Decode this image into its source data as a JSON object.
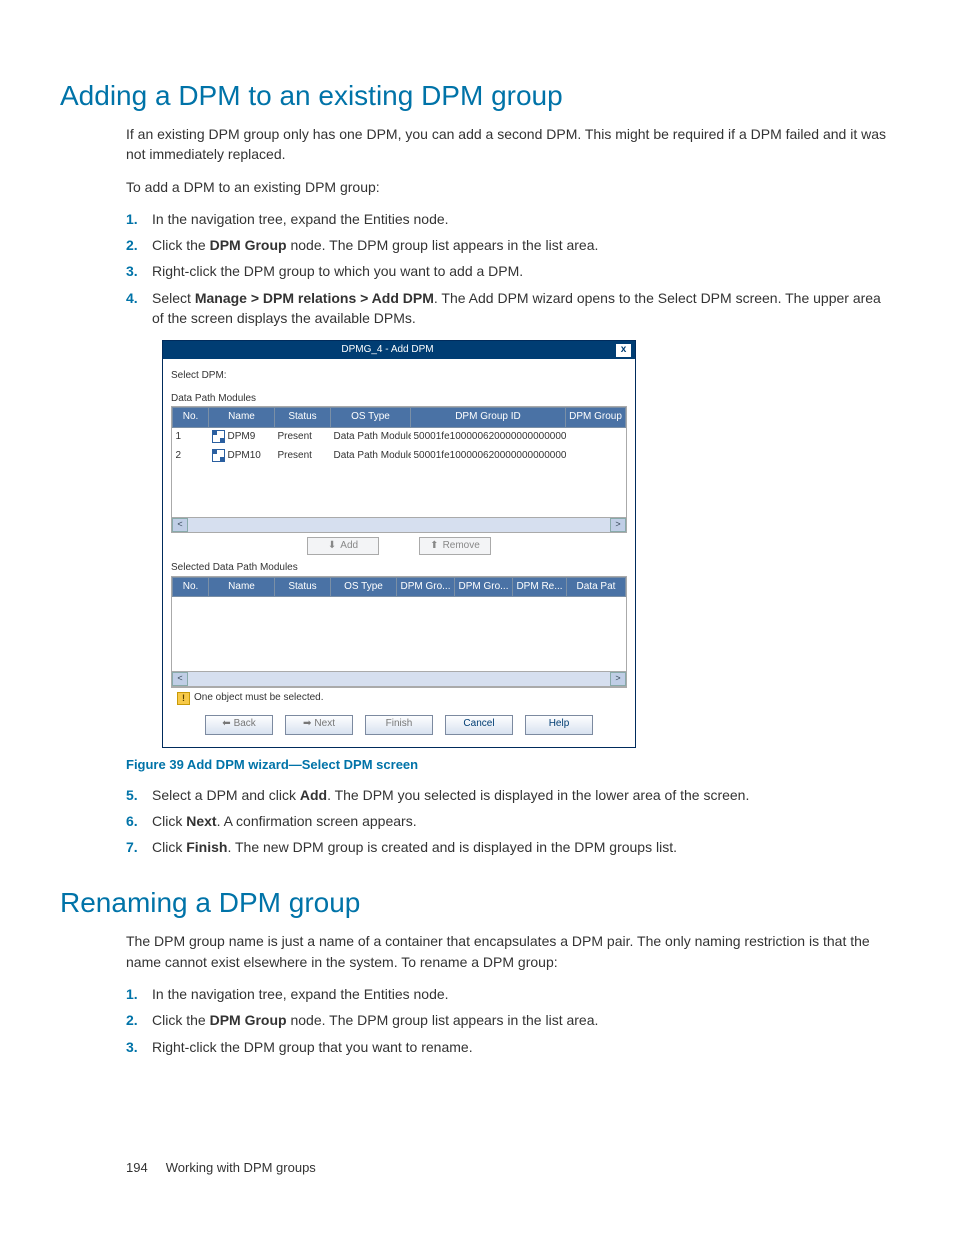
{
  "section1": {
    "heading": "Adding a DPM to an existing DPM group",
    "intro1": "If an existing DPM group only has one DPM, you can add a second DPM. This might be required if a DPM failed and it was not immediately replaced.",
    "intro2": "To add a DPM to an existing DPM group:",
    "steps14": {
      "n1": "1.",
      "t1": "In the navigation tree, expand the Entities node.",
      "n2": "2.",
      "t2a": "Click the ",
      "t2b": "DPM Group",
      "t2c": " node. The DPM group list appears in the list area.",
      "n3": "3.",
      "t3": "Right-click the DPM group to which you want to add a DPM.",
      "n4": "4.",
      "t4a": "Select ",
      "t4b": "Manage > DPM relations > Add DPM",
      "t4c": ". The Add DPM wizard opens to the Select DPM screen. The upper area of the screen displays the available DPMs."
    },
    "figcap": "Figure 39 Add DPM wizard—Select DPM screen",
    "steps57": {
      "n5": "5.",
      "t5a": "Select a DPM and click ",
      "t5b": "Add",
      "t5c": ". The DPM you selected is displayed in the lower area of the screen.",
      "n6": "6.",
      "t6a": "Click ",
      "t6b": "Next",
      "t6c": ". A confirmation screen appears.",
      "n7": "7.",
      "t7a": "Click ",
      "t7b": "Finish",
      "t7c": ". The new DPM group is created and is displayed in the DPM groups list."
    }
  },
  "dialog": {
    "title": "DPMG_4 - Add DPM",
    "close": "x",
    "select_label": "Select DPM:",
    "upper_header": "Data Path Modules",
    "lower_header": "Selected Data Path Modules",
    "cols_upper": {
      "no": "No.",
      "name": "Name",
      "status": "Status",
      "os": "OS Type",
      "gid": "DPM Group ID",
      "grp": "DPM Group"
    },
    "rows": [
      {
        "no": "1",
        "name": "DPM9",
        "status": "Present",
        "os": "Data Path Module",
        "gid": "50001fe1000006200000000000000000"
      },
      {
        "no": "2",
        "name": "DPM10",
        "status": "Present",
        "os": "Data Path Module",
        "gid": "50001fe1000006200000000000000000"
      }
    ],
    "btn_add": "Add",
    "btn_remove": "Remove",
    "cols_lower": {
      "no": "No.",
      "name": "Name",
      "status": "Status",
      "os": "OS Type",
      "g1": "DPM Gro...",
      "g2": "DPM Gro...",
      "r": "DPM Re...",
      "d": "Data Pat"
    },
    "warn": "One object must be selected.",
    "wiz": {
      "back": "Back",
      "next": "Next",
      "finish": "Finish",
      "cancel": "Cancel",
      "help": "Help"
    }
  },
  "section2": {
    "heading": "Renaming a DPM group",
    "intro": "The DPM group name is just a name of a container that encapsulates a DPM pair. The only naming restriction is that the name cannot exist elsewhere in the system. To rename a DPM group:",
    "steps": {
      "n1": "1.",
      "t1": "In the navigation tree, expand the Entities node.",
      "n2": "2.",
      "t2a": "Click the ",
      "t2b": "DPM Group",
      "t2c": " node. The DPM group list appears in the list area.",
      "n3": "3.",
      "t3": "Right-click the DPM group that you want to rename."
    }
  },
  "footer": {
    "page": "194",
    "title": "Working with DPM groups"
  }
}
